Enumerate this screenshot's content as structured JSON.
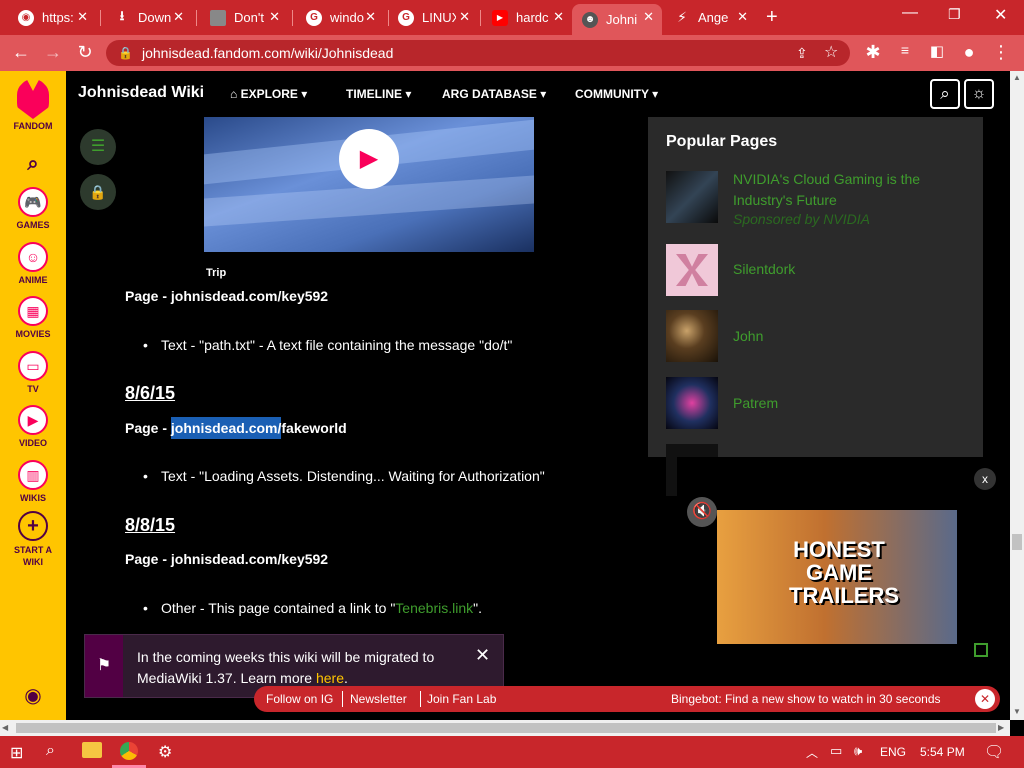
{
  "browser": {
    "tabs": [
      {
        "label": "https:",
        "icon": "chrome-icon"
      },
      {
        "label": "Downl",
        "icon": "download-icon"
      },
      {
        "label": "Don't",
        "icon": "roblox-icon"
      },
      {
        "label": "windo",
        "icon": "google-icon"
      },
      {
        "label": "LINUX",
        "icon": "google-icon"
      },
      {
        "label": "hardc",
        "icon": "youtube-icon"
      },
      {
        "label": "Johni",
        "icon": "wiki-icon"
      },
      {
        "label": "Ange",
        "icon": "lightning-icon"
      }
    ],
    "url": "johnisdead.fandom.com/wiki/Johnisdead"
  },
  "fandom_rail": {
    "brand": "FANDOM",
    "items": [
      "GAMES",
      "ANIME",
      "MOVIES",
      "TV",
      "VIDEO",
      "WIKIS",
      "START A WIKI"
    ]
  },
  "wiki_header": {
    "title": "Johnisdead Wiki",
    "nav": [
      "EXPLORE",
      "TIMELINE",
      "ARG DATABASE",
      "COMMUNITY"
    ]
  },
  "content": {
    "video_caption": "Trip",
    "entries": [
      {
        "page_prefix": "Page - ",
        "page_link": "johnisdead.com/key592"
      },
      {
        "bullet": "Text - \"path.txt\" - A text file containing the message \"do/t\""
      },
      {
        "date": "8/6/15"
      },
      {
        "page_prefix": "Page - ",
        "page_link_highlight": "johnisdead.com/",
        "page_link_rest": "fakeworld"
      },
      {
        "bullet": "Text - \"Loading Assets. Distending... Waiting for Authorization\""
      },
      {
        "date": "8/8/15"
      },
      {
        "page_prefix": "Page - ",
        "page_link": "johnisdead.com/key592"
      },
      {
        "bullet_prefix": "Other - This page contained a link to \"",
        "bullet_link": "Tenebris.link",
        "bullet_suffix": "\"."
      }
    ]
  },
  "popular_pages": {
    "title": "Popular Pages",
    "items": [
      {
        "label": "NVIDIA's Cloud Gaming is the Industry's Future",
        "sponsor": "Sponsored by NVIDIA"
      },
      {
        "label": "Silentdork"
      },
      {
        "label": "John"
      },
      {
        "label": "Patrem"
      }
    ]
  },
  "ad": {
    "headline": "HONEST GAME TRAILERS",
    "close": "x"
  },
  "notice": {
    "text": "In the coming weeks this wiki will be migrated to MediaWiki 1.37. Learn more ",
    "link": "here",
    "suffix": "."
  },
  "bottom_bar": {
    "links": [
      "Follow on IG",
      "Newsletter",
      "Join Fan Lab"
    ],
    "bingebot": "Bingebot: Find a new show to watch in 30 seconds"
  },
  "taskbar": {
    "lang": "ENG",
    "time": "5:54 PM"
  },
  "colors": {
    "accent": "#c8262b",
    "link_green": "#3f9d2d",
    "fandom_yellow": "#ffc500",
    "notice_bg": "#2e1a2e"
  }
}
